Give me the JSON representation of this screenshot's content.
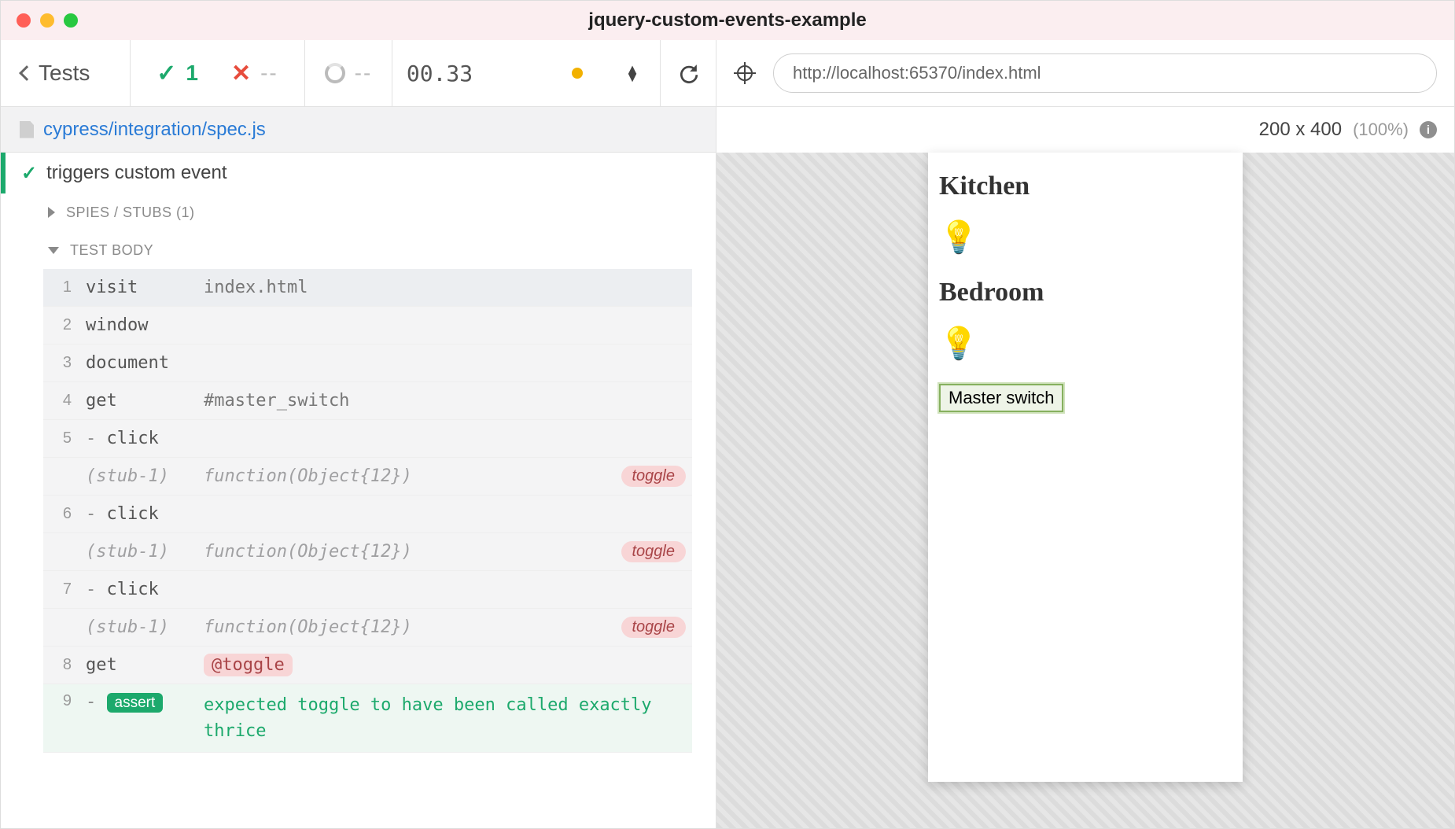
{
  "window": {
    "title": "jquery-custom-events-example"
  },
  "stats": {
    "tests_label": "Tests",
    "passed": "1",
    "failed": "--",
    "pending": "--",
    "duration": "00.33"
  },
  "file": {
    "path": "cypress/integration/spec.js"
  },
  "test": {
    "title": "triggers custom event"
  },
  "sections": {
    "spies": "SPIES / STUBS (1)",
    "body": "TEST BODY"
  },
  "commands": [
    {
      "num": "1",
      "name": "visit",
      "arg": "index.html",
      "child": false
    },
    {
      "num": "2",
      "name": "window",
      "arg": "",
      "child": false
    },
    {
      "num": "3",
      "name": "document",
      "arg": "",
      "child": false
    },
    {
      "num": "4",
      "name": "get",
      "arg": "#master_switch",
      "child": false
    },
    {
      "num": "5",
      "name": "click",
      "arg": "",
      "child": true
    },
    {
      "stub": "(stub-1)",
      "arg": "function(Object{12})",
      "pill": "toggle"
    },
    {
      "num": "6",
      "name": "click",
      "arg": "",
      "child": true
    },
    {
      "stub": "(stub-1)",
      "arg": "function(Object{12})",
      "pill": "toggle"
    },
    {
      "num": "7",
      "name": "click",
      "arg": "",
      "child": true
    },
    {
      "stub": "(stub-1)",
      "arg": "function(Object{12})",
      "pill": "toggle"
    },
    {
      "num": "8",
      "name": "get",
      "alias": "@toggle",
      "child": false
    },
    {
      "num": "9",
      "assert": true,
      "text": "expected toggle to have been called exactly thrice"
    }
  ],
  "url": "http://localhost:65370/index.html",
  "viewport": {
    "dimensions": "200 x 400",
    "zoom": "(100%)"
  },
  "app": {
    "rooms": [
      {
        "name": "Kitchen"
      },
      {
        "name": "Bedroom"
      }
    ],
    "bulb_emoji": "💡",
    "master_label": "Master switch"
  },
  "labels": {
    "assert": "assert"
  }
}
